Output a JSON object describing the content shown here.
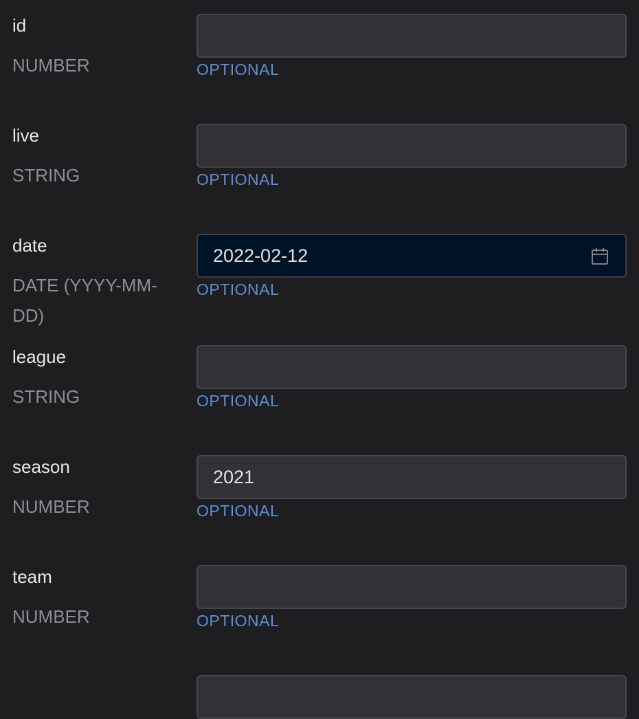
{
  "fields": [
    {
      "name": "id",
      "type": "NUMBER",
      "value": "",
      "optional_label": "OPTIONAL"
    },
    {
      "name": "live",
      "type": "STRING",
      "value": "",
      "optional_label": "OPTIONAL"
    },
    {
      "name": "date",
      "type": "DATE (YYYY-MM-DD)",
      "value": "2022-02-12",
      "optional_label": "OPTIONAL",
      "icon": "calendar-icon"
    },
    {
      "name": "league",
      "type": "STRING",
      "value": "",
      "optional_label": "OPTIONAL"
    },
    {
      "name": "season",
      "type": "NUMBER",
      "value": "2021",
      "optional_label": "OPTIONAL"
    },
    {
      "name": "team",
      "type": "NUMBER",
      "value": "",
      "optional_label": "OPTIONAL"
    }
  ],
  "colors": {
    "background": "#1e1e20",
    "input_background": "#313136",
    "date_input_background": "#001226",
    "optional_accent": "#5b8fd6",
    "type_text": "#8e8e93"
  }
}
